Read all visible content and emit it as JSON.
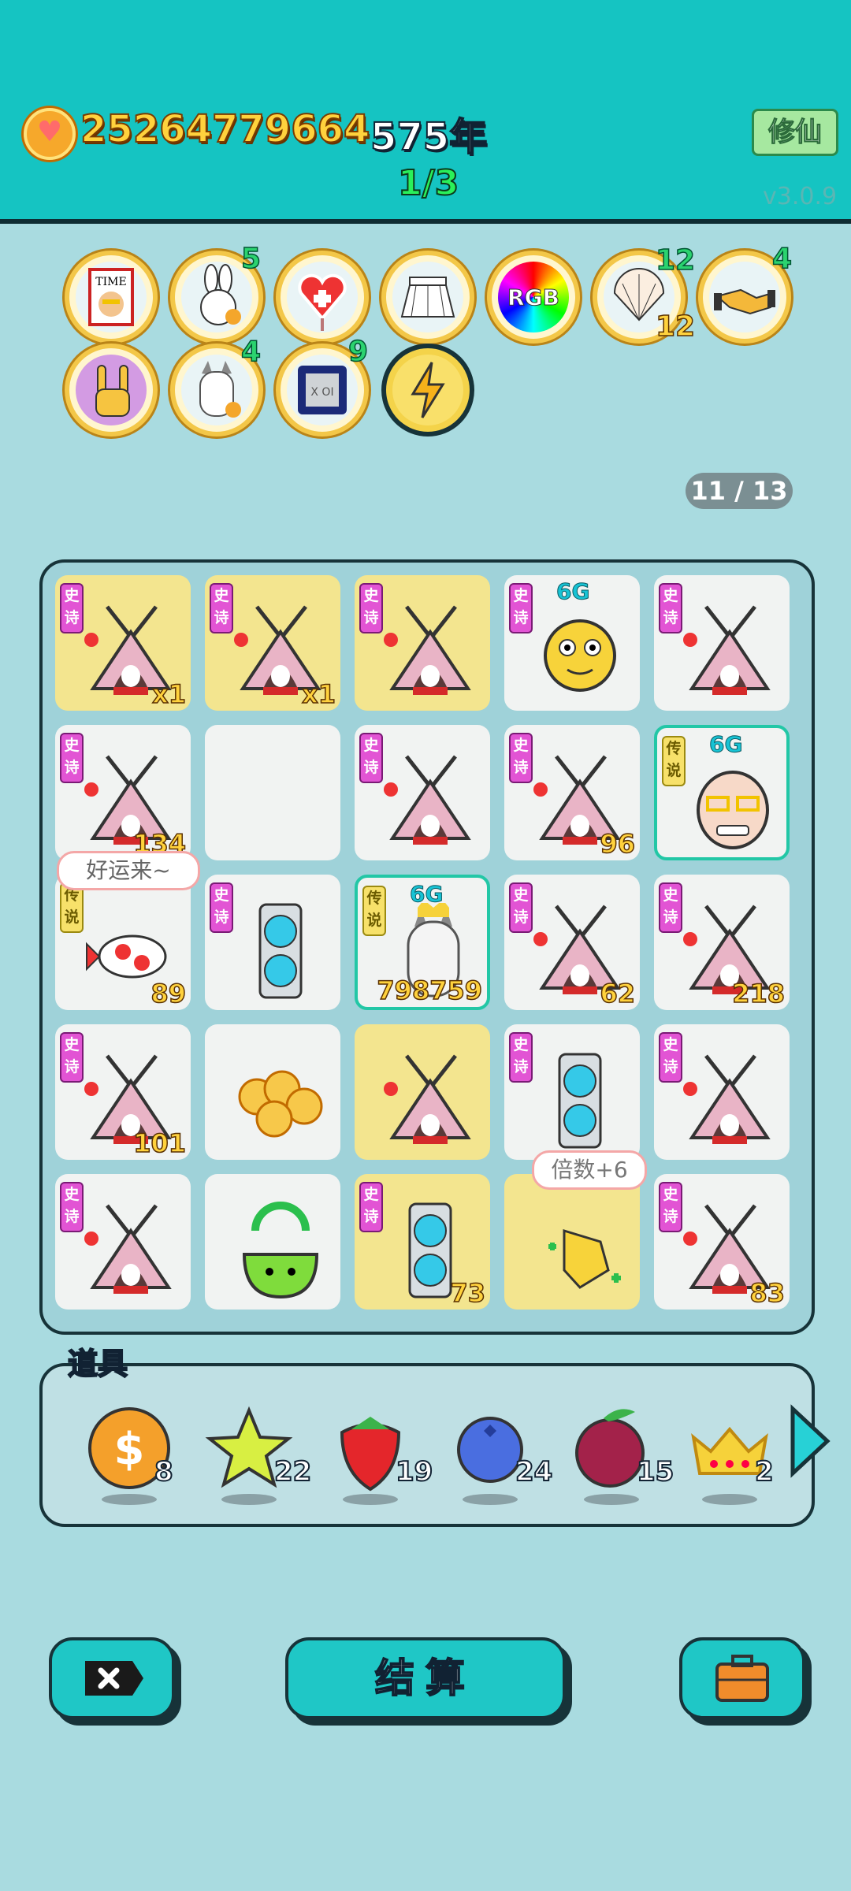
{
  "header": {
    "money": "25264779664",
    "year": "575年",
    "round": "1/3",
    "xiuxian_label": "修仙",
    "version": "v3.0.9"
  },
  "relics": [
    {
      "name": "time-magazine",
      "text": "TIME"
    },
    {
      "name": "rabbit",
      "count": "5"
    },
    {
      "name": "heart-fan"
    },
    {
      "name": "skirt"
    },
    {
      "name": "rgb",
      "text": "RGB"
    },
    {
      "name": "shell",
      "count": "12",
      "count2": "12"
    },
    {
      "name": "handshake",
      "count": "4"
    },
    {
      "name": "rock-hand"
    },
    {
      "name": "husky",
      "count": "4"
    },
    {
      "name": "cpu",
      "count": "9",
      "text": "X OI"
    },
    {
      "name": "lightning"
    }
  ],
  "pager": "11 / 13",
  "board": {
    "epic_tag": "史诗",
    "legend_tag": "传说",
    "g6": "6G",
    "bubble": "好运来~",
    "multiplier": "倍数+6",
    "cells": [
      {
        "kind": "tent",
        "tag": "epic",
        "yel": true,
        "num": "x1"
      },
      {
        "kind": "tent",
        "tag": "epic",
        "yel": true,
        "num": "x1"
      },
      {
        "kind": "tent",
        "tag": "epic",
        "yel": true,
        "num": ""
      },
      {
        "kind": "face",
        "tag": "epic",
        "g6": true,
        "num": ""
      },
      {
        "kind": "tent",
        "tag": "epic",
        "num": ""
      },
      {
        "kind": "tent",
        "tag": "epic",
        "num": "134"
      },
      {
        "kind": "empty",
        "num": ""
      },
      {
        "kind": "tent",
        "tag": "epic",
        "num": ""
      },
      {
        "kind": "tent",
        "tag": "epic",
        "num": "96"
      },
      {
        "kind": "old",
        "tag": "leg",
        "g6": true,
        "sel": true,
        "num": ""
      },
      {
        "kind": "koi",
        "tag": "leg",
        "num": "89"
      },
      {
        "kind": "gpu",
        "tag": "epic",
        "num": ""
      },
      {
        "kind": "husky",
        "tag": "leg",
        "g6": true,
        "sel": true,
        "num": "798759"
      },
      {
        "kind": "tent",
        "tag": "epic",
        "num": "62"
      },
      {
        "kind": "tent",
        "tag": "epic",
        "num": "218"
      },
      {
        "kind": "tent",
        "tag": "epic",
        "num": "101"
      },
      {
        "kind": "coins",
        "num": ""
      },
      {
        "kind": "tent",
        "yel": true,
        "num": ""
      },
      {
        "kind": "gpu",
        "tag": "epic",
        "num": ""
      },
      {
        "kind": "tent",
        "tag": "epic",
        "num": ""
      },
      {
        "kind": "tent",
        "tag": "epic",
        "num": ""
      },
      {
        "kind": "slime",
        "num": ""
      },
      {
        "kind": "gpu",
        "tag": "epic",
        "yel": true,
        "num": "73"
      },
      {
        "kind": "hand",
        "yel": true,
        "num": ""
      },
      {
        "kind": "tent",
        "tag": "epic",
        "num": "83"
      }
    ]
  },
  "items": {
    "title": "道具",
    "list": [
      {
        "name": "coin",
        "count": "8"
      },
      {
        "name": "star",
        "count": "22"
      },
      {
        "name": "strawberry",
        "count": "19"
      },
      {
        "name": "blueberry",
        "count": "24"
      },
      {
        "name": "lychee",
        "count": "15"
      },
      {
        "name": "crown",
        "count": "2"
      }
    ]
  },
  "buttons": {
    "calc_label": "结算"
  }
}
